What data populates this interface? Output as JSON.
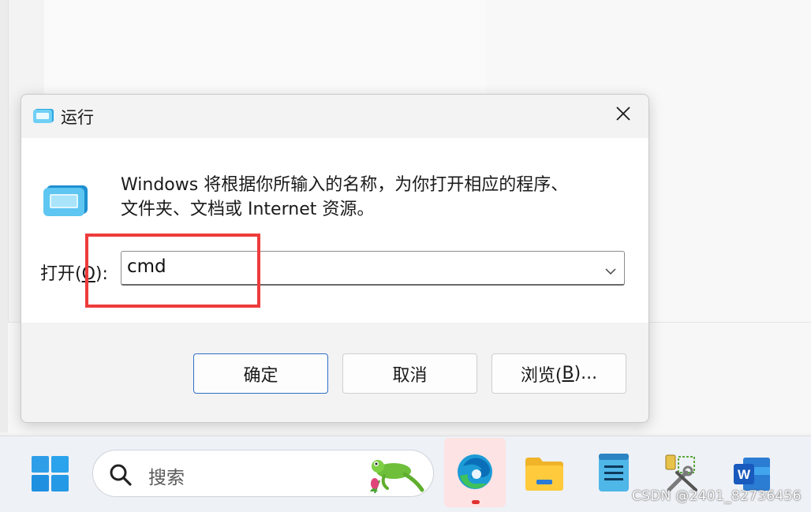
{
  "dialog": {
    "title": "运行",
    "description_line1": "Windows 将根据你所输入的名称，为你打开相应的程序、",
    "description_line2": "文件夹、文档或 Internet 资源。",
    "open_label_prefix": "打开(",
    "open_label_accel": "O",
    "open_label_suffix": "):",
    "command_value": "cmd",
    "buttons": {
      "ok": "确定",
      "cancel": "取消",
      "browse_prefix": "浏览(",
      "browse_accel": "B",
      "browse_suffix": ")..."
    },
    "icons": [
      "run-icon",
      "close-icon",
      "chevron-down-icon"
    ]
  },
  "annotation": {
    "color": "#ee3b3b"
  },
  "taskbar": {
    "search_placeholder": "搜索",
    "apps": [
      "windows-start-icon",
      "edge-icon",
      "file-explorer-icon",
      "notepad-icon",
      "tools-app-icon",
      "word-icon"
    ],
    "active_indicator_color": "#e03030"
  },
  "watermark": "CSDN @2401_82736456"
}
